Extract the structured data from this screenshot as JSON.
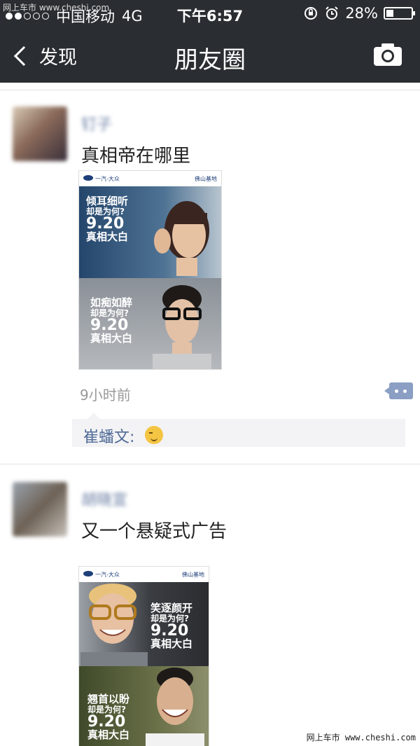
{
  "status_bar": {
    "carrier": "中国移动",
    "network": "4G",
    "time": "下午6:57",
    "battery": "28%",
    "battery_level": 0.28,
    "watermark": "网上车市 www.cheshi.com"
  },
  "nav": {
    "back_label": "发现",
    "title": "朋友圈"
  },
  "posts": [
    {
      "name": "钉子",
      "text": "真相帝在哪里",
      "time_ago": "9小时前",
      "ad_panels": [
        {
          "line1": "倾耳细听",
          "line2": "却是为何?",
          "line3": "9.20",
          "line4": "真相大白"
        },
        {
          "line1": "如痴如醉",
          "line2": "却是为何?",
          "line3": "9.20",
          "line4": "真相大白"
        }
      ],
      "ad_header": {
        "left": "一汽-大众",
        "right": "佛山基地"
      },
      "comment": {
        "author": "崔蟠文:"
      }
    },
    {
      "name": "胡晓宣",
      "text": "又一个悬疑式广告",
      "ad_panels": [
        {
          "line1": "笑逐颜开",
          "line2": "却是为何?",
          "line3": "9.20",
          "line4": "真相大白"
        },
        {
          "line1": "翘首以盼",
          "line2": "却是为何?",
          "line3": "9.20",
          "line4": "真相大白"
        }
      ],
      "ad_header": {
        "left": "一汽-大众",
        "right": "佛山基地"
      }
    }
  ],
  "watermark_bottom": "网上车市 www.cheshi.com"
}
